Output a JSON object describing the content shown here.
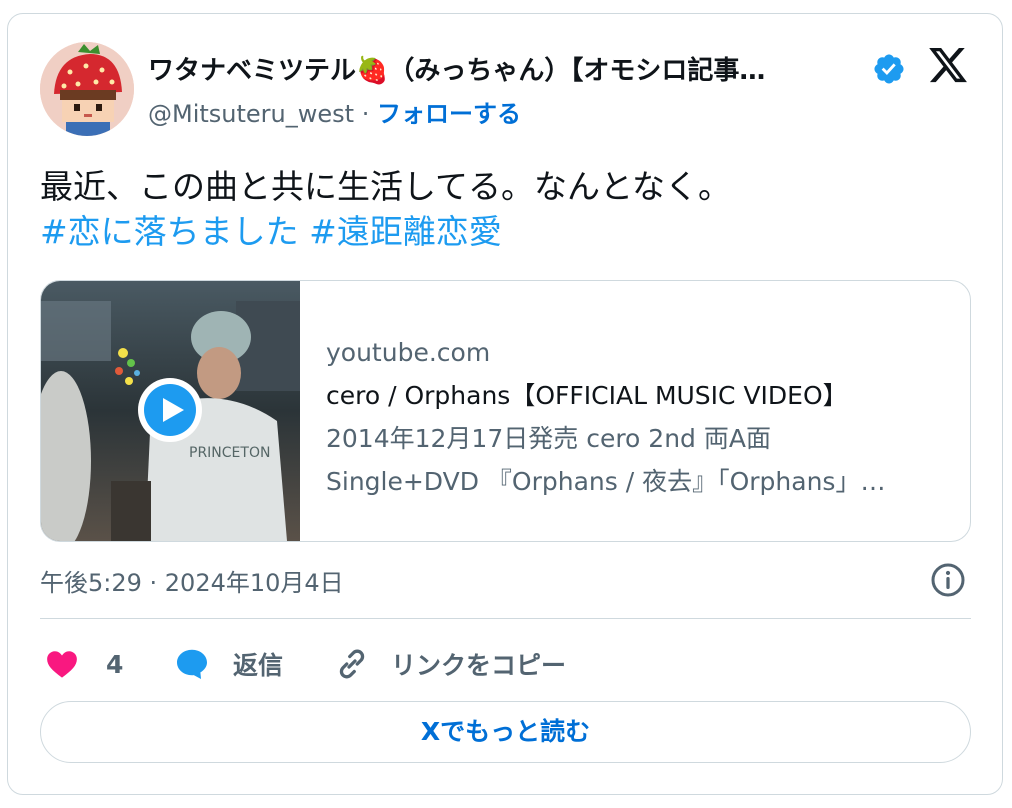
{
  "tweet": {
    "author": {
      "display_name": "ワタナベミツテル🍓（みっちゃん）【オモシロ記事…",
      "handle": "@Mitsuteru_west",
      "separator": "·",
      "follow_label": "フォローする",
      "verified": true,
      "avatar_icon": "strawberry-hat-avatar"
    },
    "text": "最近、この曲と共に生活してる。なんとなく。",
    "hashtags": "#恋に落ちました #遠距離恋愛",
    "link_card": {
      "domain": "youtube.com",
      "title": "cero / Orphans【OFFICIAL MUSIC VIDEO】",
      "description_line1": "2014年12月17日発売 cero 2nd 両A面",
      "description_line2": "Single+DVD 『Orphans / 夜去』「Orphans」…",
      "play_icon": "play-icon"
    },
    "timestamp": "午後5:29 · 2024年10月4日",
    "actions": {
      "likes_count": "4",
      "reply_label": "返信",
      "copy_link_label": "リンクをコピー"
    },
    "read_more_label": "Xでもっと読む"
  },
  "colors": {
    "link": "#1d9bf0",
    "follow": "#006fd6",
    "like": "#f91880",
    "muted": "#536471",
    "verified": "#1d9bf0",
    "border": "#cfd9de"
  }
}
